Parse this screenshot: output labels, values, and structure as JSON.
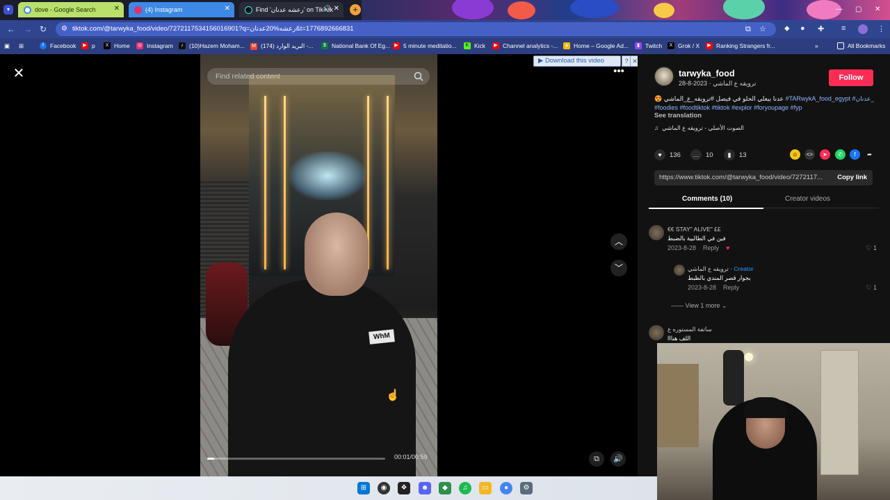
{
  "browser": {
    "tabs": [
      {
        "title": "dove - Google Search",
        "favicon": "google-icon"
      },
      {
        "title": "(4) Instagram",
        "favicon": "instagram-icon"
      },
      {
        "title": "Find 'رعشه عدنان' on TikTok",
        "favicon": "tiktok-icon"
      }
    ],
    "url": "tiktok.com/@tarwyka_food/video/7272117534156016901?q=رعشه%20عدنان&t=1776892666831",
    "bookmarks": [
      {
        "label": "Facebook",
        "color": "#1877f2"
      },
      {
        "label": "p",
        "color": "#ff0000"
      },
      {
        "label": "Home",
        "color": "#000000"
      },
      {
        "label": "Instagram",
        "color": "#e1306c"
      },
      {
        "label": "(10)Hazem Moham...",
        "color": "#111111"
      },
      {
        "label": "(174) البريد الوارد -...",
        "color": "#ea4335"
      },
      {
        "label": "National Bank Of Eg...",
        "color": "#0a7a3a"
      },
      {
        "label": "5 minute meditatio...",
        "color": "#ff0000"
      },
      {
        "label": "Kick",
        "color": "#53fc18"
      },
      {
        "label": "Channel analytics -...",
        "color": "#ff0000"
      },
      {
        "label": "Home – Google Ad...",
        "color": "#fbbc04"
      },
      {
        "label": "Twitch",
        "color": "#9146ff"
      },
      {
        "label": "Grok / X",
        "color": "#000000"
      },
      {
        "label": "Ranking Strangers fr...",
        "color": "#ff0000"
      }
    ],
    "all_bookmarks": "All Bookmarks"
  },
  "video": {
    "search_placeholder": "Find related content",
    "time": "00:01/00:59",
    "progress_fraction": 0.04,
    "shirt_text": "WhM"
  },
  "download_bar": {
    "label": "▶ Download this video",
    "help": "?",
    "close": "✕"
  },
  "panel": {
    "username": "tarwyka_food",
    "nickname": "ترويقه ع الماشي",
    "date": "2023-8-28",
    "follow_label": "Follow",
    "caption_text": "😍 عدنا بيعلي الحلو في فيصل #ترويقه_ع_الماشي",
    "caption_tags_1": "#TARwykA_food_egypt #الله_عدنان",
    "caption_tags_2": "#foodies #foodtiktok #tiktok #explor #foryoupage #fyp",
    "see_translation": "See translation",
    "sound": "الصوت الأصلي - ترويقه ع الماشي",
    "likes": "136",
    "comments": "10",
    "saves": "13",
    "share_link": "https://www.tiktok.com/@tarwyka_food/video/7272117...",
    "copy_link": "Copy link",
    "tab_comments": "Comments (10)",
    "tab_creator": "Creator videos"
  },
  "comments": [
    {
      "author": "€€ STAY\" ALIVE\" ££",
      "text": "فين في الطالبية بالضبط",
      "date": "2023-8-28",
      "reply": "Reply",
      "likes": "1"
    },
    {
      "author": "ترويقه ع الماشي",
      "creator": "Creator",
      "text": "بجوار قصر المندي بالظبط",
      "date": "2023-8-28",
      "reply": "Reply",
      "likes": "1"
    },
    {
      "author": "ساتفة المستوره ع",
      "text": "اللف هنااا",
      "date": "",
      "reply": "",
      "likes": ""
    }
  ],
  "view_more": "View 1 more",
  "colors": {
    "accent": "#fe2c55",
    "panel_bg": "#121212",
    "tag_blue": "#8fb5ff",
    "creator_blue": "#2f9bff"
  }
}
